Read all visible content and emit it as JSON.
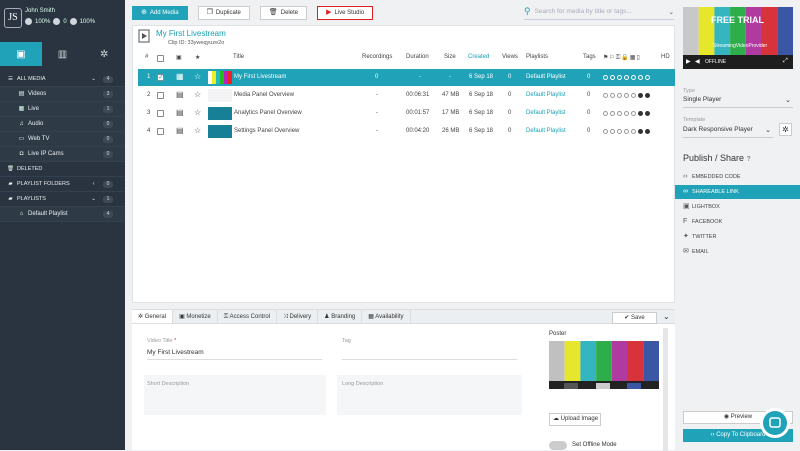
{
  "user": {
    "initials": "JS",
    "name": "John Smith",
    "stat1": "100%",
    "stat2": "0",
    "stat3": "100%"
  },
  "sidebar": {
    "all_media": {
      "label": "ALL MEDIA",
      "count": "4"
    },
    "items": [
      {
        "label": "Videos",
        "count": "3"
      },
      {
        "label": "Live",
        "count": "1"
      },
      {
        "label": "Audio",
        "count": "0"
      },
      {
        "label": "Web TV",
        "count": "0"
      },
      {
        "label": "Live IP Cams",
        "count": "0"
      }
    ],
    "deleted": "DELETED",
    "playlist_folders": {
      "label": "PLAYLIST FOLDERS",
      "count": "0"
    },
    "playlists": {
      "label": "PLAYLISTS",
      "count": "1"
    },
    "default_playlist": {
      "label": "Default Playlist",
      "count": "4"
    }
  },
  "toolbar": {
    "add": "Add Media",
    "duplicate": "Duplicate",
    "delete": "Delete",
    "live": "Live Studio"
  },
  "search": {
    "placeholder": "Search for media by title or tags..."
  },
  "media": {
    "title": "My First Livestream",
    "clip_id": "Clip ID: 33yweqyuze2o",
    "columns": {
      "num": "#",
      "title": "Title",
      "recordings": "Recordings",
      "duration": "Duration",
      "size": "Size",
      "created": "Created",
      "views": "Views",
      "playlists": "Playlists",
      "tags": "Tags",
      "hd": "HD"
    },
    "rows": [
      {
        "num": "1",
        "title": "My First Livestream",
        "recordings": "0",
        "duration": "-",
        "size": "-",
        "created": "6 Sep 18",
        "views": "0",
        "playlists": "Default Playlist",
        "tags": "0"
      },
      {
        "num": "2",
        "title": "Media Panel Overview",
        "recordings": "-",
        "duration": "00:06:31",
        "size": "47 MB",
        "created": "6 Sep 18",
        "views": "0",
        "playlists": "Default Playlist",
        "tags": "0"
      },
      {
        "num": "3",
        "title": "Analytics Panel Overview",
        "recordings": "-",
        "duration": "00:01:57",
        "size": "17 MB",
        "created": "6 Sep 18",
        "views": "0",
        "playlists": "Default Playlist",
        "tags": "0"
      },
      {
        "num": "4",
        "title": "Settings Panel Overview",
        "recordings": "-",
        "duration": "00:04:20",
        "size": "26 MB",
        "created": "6 Sep 18",
        "views": "0",
        "playlists": "Default Playlist",
        "tags": "0"
      }
    ]
  },
  "editor": {
    "tabs": [
      "General",
      "Monetize",
      "Access Control",
      "Delivery",
      "Branding",
      "Availability"
    ],
    "save": "Save",
    "video_title_label": "Video Title",
    "video_title_value": "My First Livestream",
    "tag_label": "Tag",
    "short_desc_label": "Short Description",
    "long_desc_label": "Long Description",
    "poster_label": "Poster",
    "upload_image": "Upload Image",
    "offline_mode": "Set Offline Mode"
  },
  "right": {
    "free_trial": "FREE TRIAL",
    "provider": "StreamingVideoProvider",
    "offline": "OFFLINE",
    "type_label": "Type",
    "type_value": "Single Player",
    "template_label": "Template",
    "template_value": "Dark Responsive Player",
    "publish_title": "Publish / Share",
    "share_items": [
      "EMBEDDED CODE",
      "SHAREABLE LINK",
      "LIGHTBOX",
      "FACEBOOK",
      "TWITTER",
      "EMAIL"
    ],
    "preview": "Preview",
    "copy": "Copy To Clipboard"
  },
  "colors": {
    "accent": "#20a3b8",
    "sidebar": "#2a3340",
    "live": "#dd2222"
  }
}
